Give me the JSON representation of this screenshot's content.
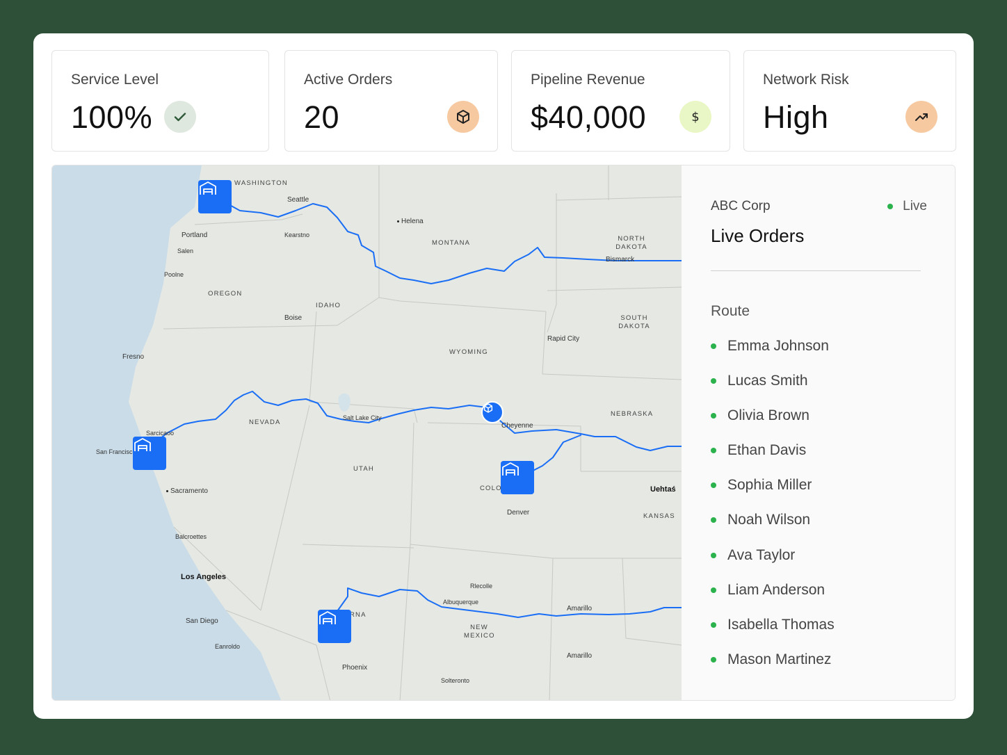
{
  "kpis": [
    {
      "label": "Service Level",
      "value": "100%",
      "icon": "check-icon",
      "badge_color": "#dfe8df",
      "icon_color": "#2e5a3a"
    },
    {
      "label": "Active Orders",
      "value": "20",
      "icon": "box-icon",
      "badge_color": "#f6c9a0",
      "icon_color": "#222"
    },
    {
      "label": "Pipeline Revenue",
      "value": "$40,000",
      "icon": "dollar-icon",
      "badge_color": "#e9f7c6",
      "icon_color": "#222"
    },
    {
      "label": "Network Risk",
      "value": "High",
      "icon": "trend-up-icon",
      "badge_color": "#f6c9a0",
      "icon_color": "#222"
    }
  ],
  "map": {
    "states": [
      "WASHINGTON",
      "MONTANA",
      "NORTH DAKOTA",
      "OREGON",
      "IDAHO",
      "SOUTH DAKOTA",
      "WYOMING",
      "NEVADA",
      "NEBRASKA",
      "UTAH",
      "COLO",
      "KANSAS",
      "RNA",
      "NEW MEXICO"
    ],
    "cities": [
      "Seattle",
      "Helena",
      "Portland",
      "Kearstno",
      "Salen",
      "Bismarck",
      "Poolne",
      "Boise",
      "Rapid City",
      "Fresno",
      "Salt Lake City",
      "Cheyenne",
      "Sarcicaoo",
      "San Francisco",
      "Sacramento",
      "Denver",
      "Balcroettes",
      "Rlecolle",
      "Albuquerque",
      "Amarillo",
      "San Diego",
      "Eanroldo",
      "Phoenix",
      "Amarillo",
      "Solteronto"
    ],
    "bold_cities": [
      "Los Angeles",
      "Uehtaś"
    ]
  },
  "panel": {
    "company": "ABC Corp",
    "status": "Live",
    "title": "Live Orders",
    "route_label": "Route",
    "drivers": [
      "Emma Johnson",
      "Lucas Smith",
      "Olivia Brown",
      "Ethan Davis",
      "Sophia Miller",
      "Noah Wilson",
      "Ava Taylor",
      "Liam Anderson",
      "Isabella Thomas",
      "Mason Martinez"
    ]
  },
  "colors": {
    "accent": "#1a6ef5",
    "live": "#2bb24c",
    "background": "#2e4f38"
  }
}
